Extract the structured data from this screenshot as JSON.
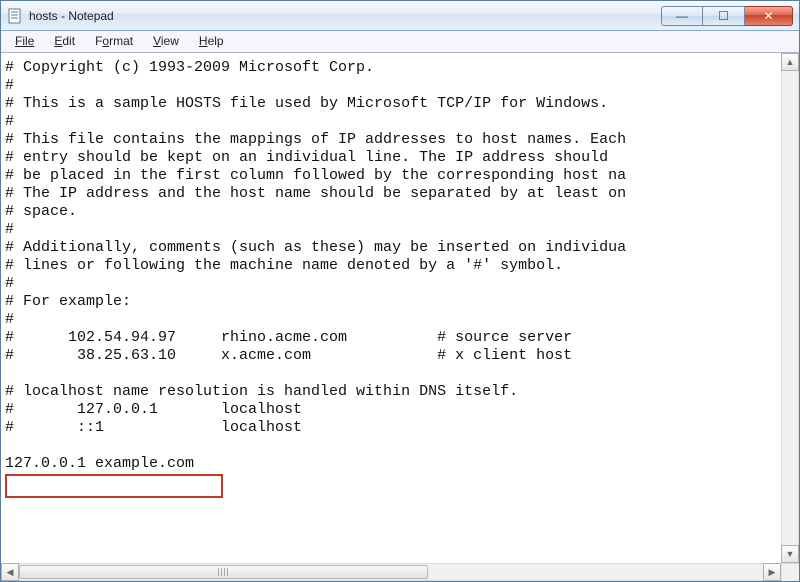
{
  "window": {
    "title": "hosts - Notepad"
  },
  "menu": {
    "file": "File",
    "edit": "Edit",
    "format": "Format",
    "view": "View",
    "help": "Help"
  },
  "content": {
    "lines": [
      "# Copyright (c) 1993-2009 Microsoft Corp.",
      "#",
      "# This is a sample HOSTS file used by Microsoft TCP/IP for Windows.",
      "#",
      "# This file contains the mappings of IP addresses to host names. Each",
      "# entry should be kept on an individual line. The IP address should",
      "# be placed in the first column followed by the corresponding host na",
      "# The IP address and the host name should be separated by at least on",
      "# space.",
      "#",
      "# Additionally, comments (such as these) may be inserted on individua",
      "# lines or following the machine name denoted by a '#' symbol.",
      "#",
      "# For example:",
      "#",
      "#      102.54.94.97     rhino.acme.com          # source server",
      "#       38.25.63.10     x.acme.com              # x client host",
      "",
      "# localhost name resolution is handled within DNS itself.",
      "#       127.0.0.1       localhost",
      "#       ::1             localhost",
      "",
      "127.0.0.1 example.com"
    ],
    "highlighted_line": "127.0.0.1 example.com"
  },
  "icons": {
    "minimize": "—",
    "maximize": "☐",
    "close": "✕",
    "up": "▲",
    "down": "▼",
    "left": "◀",
    "right": "▶"
  }
}
